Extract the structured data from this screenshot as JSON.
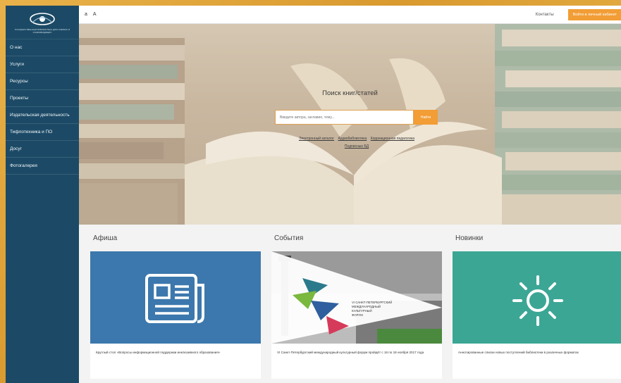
{
  "sidebar": {
    "logo_text": "ГОСУДАРСТВЕННАЯ БИБЛИОТЕКА ДЛЯ СЛЕПЫХ И СЛАБОВИДЯЩИХ",
    "items": [
      {
        "label": "О нас"
      },
      {
        "label": "Услуги"
      },
      {
        "label": "Ресурсы"
      },
      {
        "label": "Проекты"
      },
      {
        "label": "Издательская деятельность"
      },
      {
        "label": "Тифлотехника и ПО"
      },
      {
        "label": "Досуг"
      },
      {
        "label": "Фотогалерея"
      }
    ]
  },
  "topbar": {
    "font_small": "a",
    "font_large": "A",
    "contacts": "Контакты",
    "cabinet": "Войти в личный кабинет"
  },
  "hero": {
    "title": "Поиск книг/статей",
    "search_placeholder": "Введите автора, заглавие, тему...",
    "search_button": "Найти",
    "links": [
      "Электронный каталог",
      "Аудиобиблиотека",
      "Коррекционная педагогика",
      "Подписные БД"
    ]
  },
  "sections": {
    "afisha": {
      "title": "Афиша",
      "card_text": "Круглый стол «Вопросы информационной поддержки инклюзивного образования»",
      "icon": "newspaper-icon"
    },
    "events": {
      "title": "События",
      "card_text": "VI Санкт-Петербургский международный культурный форум пройдёт с 16 по 18 ноября 2017 года",
      "poster_text": "VI САНКТ-ПЕТЕРБУРГСКИЙ МЕЖДУНАРОДНЫЙ КУЛЬТУРНЫЙ ФОРУМ"
    },
    "novelties": {
      "title": "Новинки",
      "card_text": "Аннотированные списки новых поступлений библиотеки в различных форматах",
      "icon": "sun-bulb-icon"
    }
  },
  "colors": {
    "sidebar": "#1c4a66",
    "accent": "#f29d35",
    "afisha_card": "#3c78ad",
    "novelties_card": "#3ca695"
  }
}
